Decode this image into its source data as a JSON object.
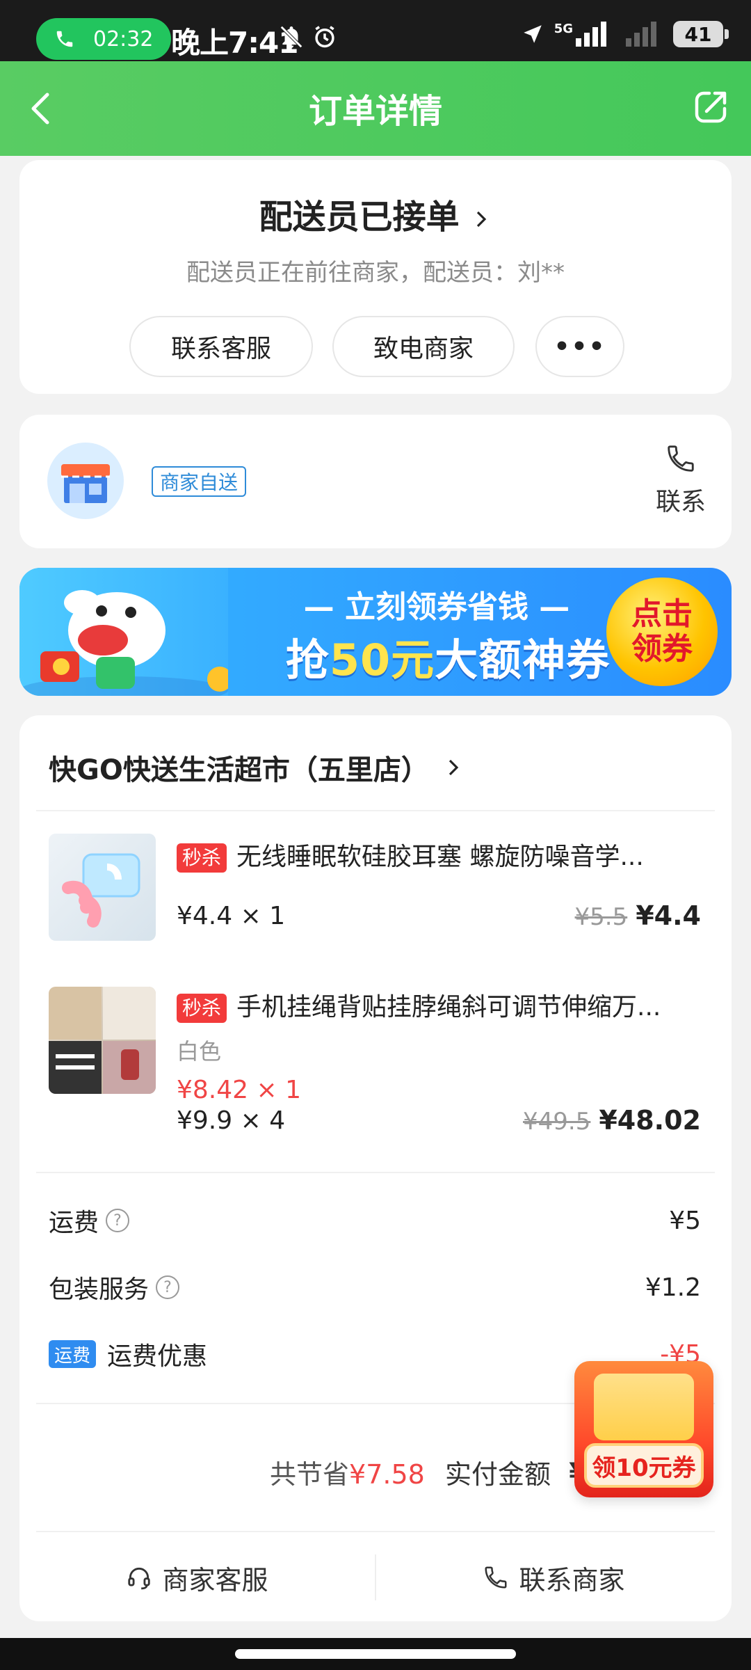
{
  "status_bar": {
    "call_time": "02:32",
    "time": "晚上7:41",
    "network": "5G",
    "battery": "41"
  },
  "header": {
    "title": "订单详情"
  },
  "order_status": {
    "title": "配送员已接单",
    "subtitle": "配送员正在前往商家，配送员：刘**",
    "buttons": [
      "联系客服",
      "致电商家",
      "•••"
    ]
  },
  "store_card": {
    "delivery_tag": "商家自送",
    "contact_label": "联系"
  },
  "banner": {
    "line1": "— 立刻领券省钱 —",
    "line2_prefix": "抢",
    "line2_amount": "50元",
    "line2_suffix": "大额神券",
    "cta": "点击领券"
  },
  "shop": {
    "name": "快GO快送生活超市（五里店）"
  },
  "items": [
    {
      "badge": "秒杀",
      "title": "无线睡眠软硅胶耳塞 螺旋防噪音学...",
      "unit": "¥4.4 × 1",
      "original_price": "¥5.5",
      "price": "¥4.4"
    },
    {
      "badge": "秒杀",
      "title": "手机挂绳背贴挂脖绳斜可调节伸缩万...",
      "spec": "白色",
      "unit_discount": "¥8.42 × 1",
      "unit": "¥9.9 × 4",
      "original_price": "¥49.5",
      "price": "¥48.02"
    }
  ],
  "fees": {
    "shipping_label": "运费",
    "shipping_value": "¥5",
    "packing_label": "包装服务",
    "packing_value": "¥1.2",
    "discount_badge": "运费",
    "discount_label": "运费优惠",
    "discount_value": "-¥5"
  },
  "totals": {
    "saved_label": "共节省",
    "saved_value": "¥7.58",
    "paid_label": "实付金额",
    "paid_value_visible": "¥"
  },
  "bottom_actions": {
    "service": "商家客服",
    "contact": "联系商家"
  },
  "floating_coupon": {
    "label": "领10元券"
  },
  "colors": {
    "brand_green": "#4cca5f",
    "accent_red": "#f04545",
    "accent_blue": "#2f8cf0"
  }
}
